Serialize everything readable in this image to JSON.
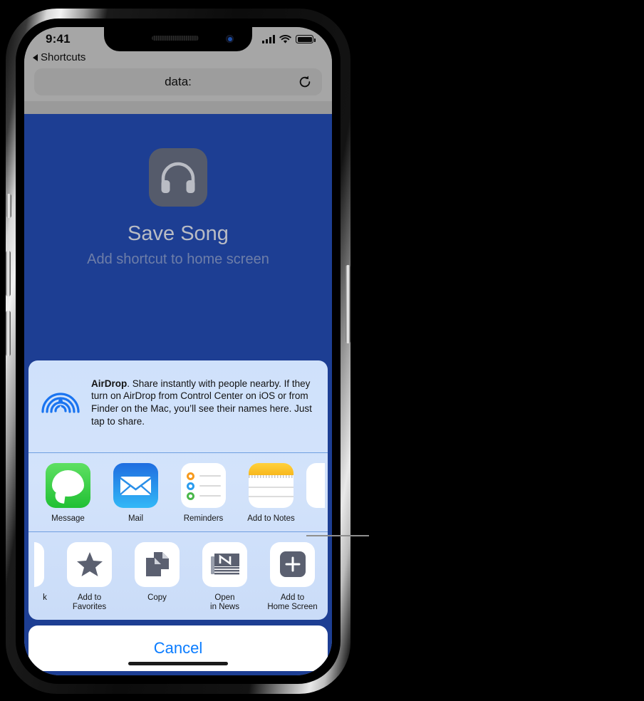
{
  "status_bar": {
    "time": "9:41",
    "signal_icon": "cellular-signal-icon",
    "wifi_icon": "wifi-icon",
    "battery_icon": "battery-icon"
  },
  "browser": {
    "back_label": "Shortcuts",
    "back_icon": "triangle-left-icon",
    "url_text": "data:",
    "reload_icon": "reload-icon"
  },
  "page": {
    "app_icon": "headphones-icon",
    "title": "Save Song",
    "subtitle": "Add shortcut to home screen",
    "background_color": "#1d3e93"
  },
  "share_sheet": {
    "airdrop": {
      "icon": "airdrop-icon",
      "title": "AirDrop",
      "text": ". Share instantly with people nearby. If they turn on AirDrop from Control Center on iOS or from Finder on the Mac, you’ll see their names here. Just tap to share."
    },
    "app_row": [
      {
        "label": "Message",
        "icon": "messages-app-icon"
      },
      {
        "label": "Mail",
        "icon": "mail-app-icon"
      },
      {
        "label": "Reminders",
        "icon": "reminders-app-icon"
      },
      {
        "label": "Add to Notes",
        "icon": "notes-app-icon"
      },
      {
        "label": "",
        "icon": "partial-app-icon"
      }
    ],
    "action_row": [
      {
        "label": "k",
        "icon": "partial-bookmark-icon"
      },
      {
        "label": "Add to\nFavorites",
        "icon": "star-icon"
      },
      {
        "label": "Copy",
        "icon": "copy-icon"
      },
      {
        "label": "Open\nin News",
        "icon": "news-icon"
      },
      {
        "label": "Add to\nHome Screen",
        "icon": "plus-square-icon"
      }
    ],
    "cancel_label": "Cancel",
    "cancel_color": "#0a7cff"
  },
  "callout": {
    "line_color": "#8e8e8e"
  }
}
